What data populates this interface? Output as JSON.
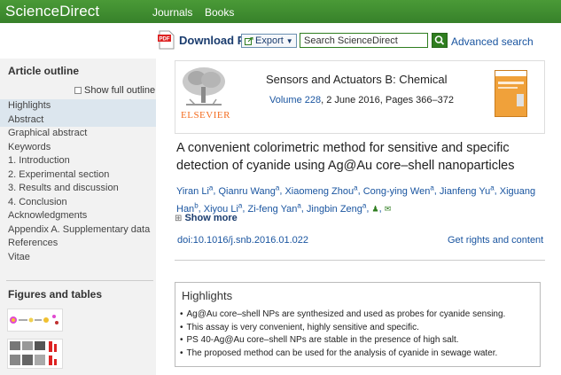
{
  "topbar": {
    "brand": "ScienceDirect",
    "nav": [
      "Journals",
      "Books"
    ]
  },
  "toolbar": {
    "download_label": "Download PDF",
    "export_label": "Export",
    "search_placeholder": "Search ScienceDirect",
    "advanced_search": "Advanced search"
  },
  "sidebar": {
    "outline_title": "Article outline",
    "show_full_outline": "Show full outline",
    "items": [
      "Highlights",
      "Abstract",
      "Graphical abstract",
      "Keywords",
      "1. Introduction",
      "2. Experimental section",
      "3. Results and discussion",
      "4. Conclusion",
      "Acknowledgments",
      "Appendix A. Supplementary data",
      "References",
      "Vitae"
    ],
    "figures_title": "Figures and tables"
  },
  "article": {
    "publisher": "ELSEVIER",
    "journal": "Sensors and Actuators B: Chemical",
    "volume_link": "Volume 228",
    "volume_rest": ", 2 June 2016, Pages 366–372",
    "title": "A convenient colorimetric method for sensitive and specific detection of cyanide using Ag@Au core–shell nanoparticles",
    "authors": [
      {
        "name": "Yiran Li",
        "sup": "a"
      },
      {
        "name": "Qianru Wang",
        "sup": "a"
      },
      {
        "name": "Xiaomeng Zhou",
        "sup": "a"
      },
      {
        "name": "Cong-ying Wen",
        "sup": "a"
      },
      {
        "name": "Jianfeng Yu",
        "sup": "a"
      },
      {
        "name": "Xiguang Han",
        "sup": "b"
      },
      {
        "name": "Xiyou Li",
        "sup": "a"
      },
      {
        "name": "Zi-feng Yan",
        "sup": "a"
      },
      {
        "name": "Jingbin Zeng",
        "sup": "a"
      }
    ],
    "show_more": "Show more",
    "doi": "doi:10.1016/j.snb.2016.01.022",
    "rights": "Get rights and content"
  },
  "highlights": {
    "title": "Highlights",
    "items": [
      "Ag@Au core–shell NPs are synthesized and used as probes for cyanide sensing.",
      "This assay is very convenient, highly sensitive and specific.",
      "PS 40-Ag@Au core–shell NPs are stable in the presence of high salt.",
      "The proposed method can be used for the analysis of cyanide in sewage water."
    ]
  },
  "colors": {
    "topbar": "#3f8b2f",
    "link": "#1a55a0",
    "publisher": "#f36d21"
  }
}
